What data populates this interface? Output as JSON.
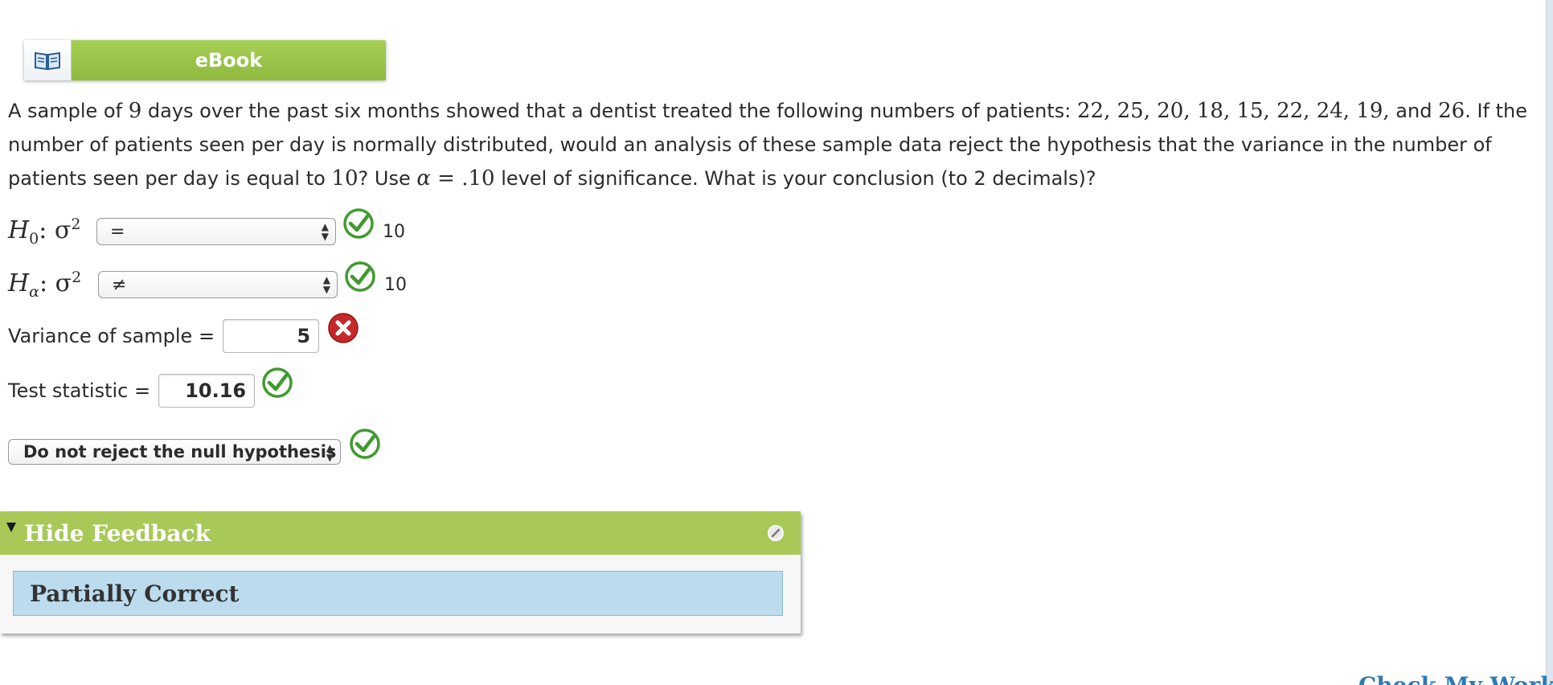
{
  "ebook": {
    "label": "eBook"
  },
  "question": {
    "p1": "A sample of ",
    "n": "9",
    "p2": " days over the past six months showed that a dentist treated the following numbers of patients: ",
    "data_values": "22, 25, 20, 18, 15, 22, 24, 19,",
    "p3": " and ",
    "last_value": "26",
    "p4": ". If the number of patients seen per day is normally distributed, would an analysis of these sample data reject the hypothesis that the variance in the number of patients seen per day is equal to ",
    "hyp_value": "10",
    "p5": "? Use ",
    "alpha_sym": "α",
    "alpha_eq": " = .10",
    "p6": " level of significance. What is your conclusion (to 2 decimals)?"
  },
  "h0": {
    "label_main": "H",
    "label_sub": "0",
    "label_rest": ": σ",
    "label_sup": "2",
    "select_value": "=",
    "value": "10",
    "status": "correct"
  },
  "ha": {
    "label_main": "H",
    "label_sub": "α",
    "label_rest": ": σ",
    "label_sup": "2",
    "select_value": "≠",
    "value": "10",
    "status": "correct"
  },
  "variance": {
    "label": "Variance of sample =",
    "value": "5",
    "status": "incorrect"
  },
  "test_statistic": {
    "label": "Test statistic =",
    "value": "10.16",
    "status": "correct"
  },
  "conclusion": {
    "select_value": "Do not reject the null hypothesis",
    "status": "correct"
  },
  "feedback": {
    "header": "Hide Feedback",
    "status": "Partially Correct"
  },
  "bottom_link": {
    "label": "Check My Work"
  },
  "colors": {
    "accent_green": "#a8c958",
    "feedback_blue": "#bcdcee",
    "link_blue": "#2d7bb5",
    "correct_green": "#3f9a2e",
    "incorrect_red": "#c8282a"
  }
}
